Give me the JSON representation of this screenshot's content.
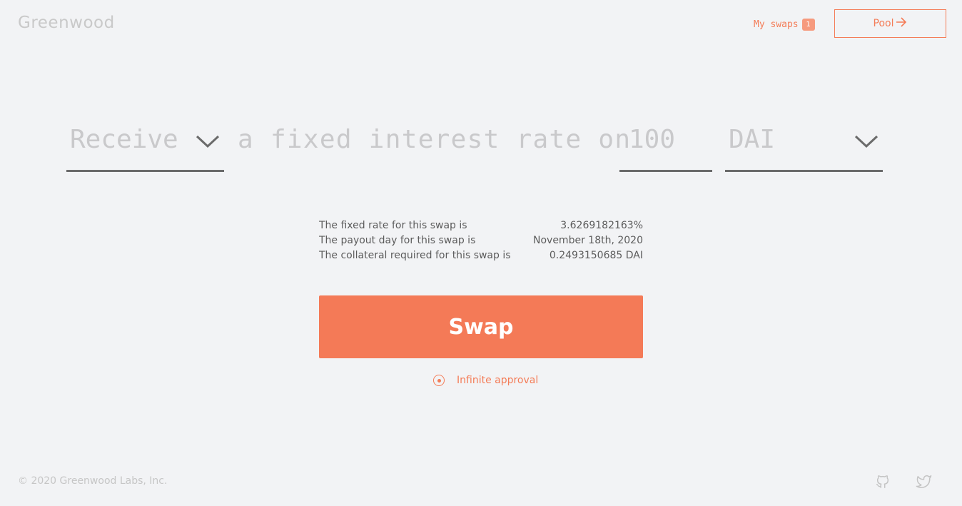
{
  "header": {
    "logo": "Greenwood",
    "my_swaps_label": "My swaps",
    "my_swaps_count": "1",
    "pool_label": "Pool"
  },
  "sentence": {
    "action": "Receive",
    "middle_text": "a fixed interest rate on",
    "amount": "100",
    "token": "DAI"
  },
  "details": {
    "rows": [
      {
        "label": "The fixed rate for this swap is",
        "value": "3.6269182163%"
      },
      {
        "label": "The payout day for this swap is",
        "value": "November 18th, 2020"
      },
      {
        "label": "The collateral required for this swap is",
        "value": "0.2493150685 DAI"
      }
    ]
  },
  "swap_button": "Swap",
  "infinite_approval_label": "Infinite approval",
  "footer": {
    "copyright": "© 2020 Greenwood Labs, Inc."
  },
  "colors": {
    "accent": "#f47a57",
    "background": "#f2f3f5"
  },
  "icons": [
    "arrow-right-icon",
    "chevron-down-icon",
    "github-icon",
    "twitter-icon"
  ]
}
